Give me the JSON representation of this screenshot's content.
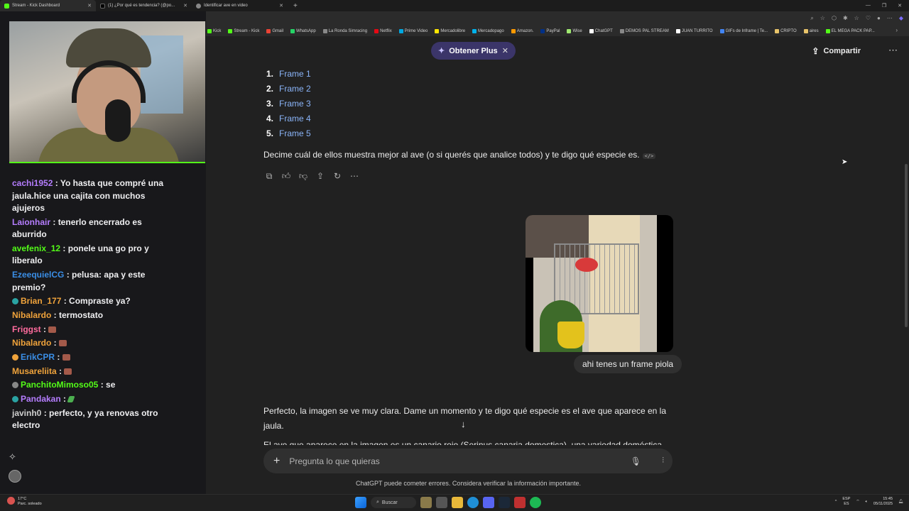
{
  "browser": {
    "tabs": [
      {
        "title": "Stream - Kick Dashboard",
        "favicon_color": "#53fc18"
      },
      {
        "title": "(1) ¿Por qué es tendencia? (@po...",
        "favicon_color": "#000000"
      },
      {
        "title": "Identificar ave en video",
        "favicon_color": "#888888"
      }
    ],
    "new_tab": "+",
    "bookmarks": [
      {
        "label": "Kick",
        "color": "#53fc18"
      },
      {
        "label": "Stream - Kick",
        "color": "#53fc18"
      },
      {
        "label": "Gmail",
        "color": "#ea4335"
      },
      {
        "label": "WhatsApp",
        "color": "#25d366"
      },
      {
        "label": "La Ronda Simracing",
        "color": "#888888"
      },
      {
        "label": "Netflix",
        "color": "#e50914"
      },
      {
        "label": "Prime Video",
        "color": "#00a8e1"
      },
      {
        "label": "Mercadolibre",
        "color": "#ffe600"
      },
      {
        "label": "Mercadopago",
        "color": "#00b1ea"
      },
      {
        "label": "Amazon.",
        "color": "#ff9900"
      },
      {
        "label": "PayPal",
        "color": "#003087"
      },
      {
        "label": "Wise",
        "color": "#9fe870"
      },
      {
        "label": "ChatGPT",
        "color": "#ffffff"
      },
      {
        "label": "DEMOS PAL STREAM",
        "color": "#888888"
      },
      {
        "label": "JUAN TURRITO",
        "color": "#ffffff"
      },
      {
        "label": "GIFs de Inframe | Te...",
        "color": "#4285f4"
      },
      {
        "label": "CRIPTO",
        "color": "#e8c46a"
      },
      {
        "label": "aires",
        "color": "#e8c46a"
      },
      {
        "label": "EL MEGA PACK PAP...",
        "color": "#53fc18"
      }
    ]
  },
  "chat": {
    "messages": [
      {
        "user": "cachi1952",
        "color": "#b57dff",
        "badge": "",
        "text": "Yo hasta que compré una jaula.hice una cajita con muchos ajujeros",
        "emote": ""
      },
      {
        "user": "Laionhair",
        "color": "#b57dff",
        "badge": "",
        "text": "tenerlo encerrado es aburrido",
        "emote": ""
      },
      {
        "user": "avefenix_12",
        "color": "#53fc18",
        "badge": "",
        "text": "ponele una go pro y liberalo",
        "emote": ""
      },
      {
        "user": "EzeequielCG",
        "color": "#3a8ee6",
        "badge": "",
        "text": "pelusa: apa y este premio?",
        "emote": ""
      },
      {
        "user": "Brian_177",
        "color": "#f0a33b",
        "badge": "#2aa3a3",
        "text": "Compraste ya?",
        "emote": ""
      },
      {
        "user": "Nibalardo",
        "color": "#f0a33b",
        "badge": "",
        "text": "termostato",
        "emote": ""
      },
      {
        "user": "Friggst",
        "color": "#ff6b9d",
        "badge": "",
        "text": "",
        "emote": "red"
      },
      {
        "user": "Nibalardo",
        "color": "#f0a33b",
        "badge": "",
        "text": "",
        "emote": "red"
      },
      {
        "user": "ErikCPR",
        "color": "#3a8ee6",
        "badge": "#f0a33b",
        "text": "",
        "emote": "red"
      },
      {
        "user": "Musareliita",
        "color": "#f0a33b",
        "badge": "",
        "text": "",
        "emote": "red"
      },
      {
        "user": "PanchitoMimoso05",
        "color": "#53fc18",
        "badge": "#888888",
        "text": "se",
        "emote": ""
      },
      {
        "user": "Pandakan",
        "color": "#b57dff",
        "badge": "#2aa3a3",
        "text": "",
        "emote": "green"
      },
      {
        "user": "javinh0",
        "color": "#cfcfcf",
        "badge": "",
        "text": "perfecto, y ya renovas otro electro",
        "emote": ""
      }
    ]
  },
  "chatgpt": {
    "get_plus": "Obtener Plus",
    "share": "Compartir",
    "frames": [
      "Frame 1",
      "Frame 2",
      "Frame 3",
      "Frame 4",
      "Frame 5"
    ],
    "frame_numbers": [
      "1.",
      "2.",
      "3.",
      "4.",
      "5."
    ],
    "assistant_text": "Decime cuál de ellos muestra mejor al ave (o si querés que analice todos) y te digo qué especie es.",
    "code_chip": "</>",
    "user_message": "ahi tenes un frame piola",
    "answer": "Perfecto, la imagen se ve muy clara. Dame un momento y te digo qué especie es el ave que aparece en la jaula.",
    "answer_cut": "El ave que aparece en la imagen es un canario rojo (Serinus canaria domestica), una variedad doméstica del",
    "composer_placeholder": "Pregunta lo que quieras",
    "disclaimer": "ChatGPT puede cometer errores. Considera verificar la información importante."
  },
  "taskbar": {
    "weather_temp": "17°C",
    "weather_desc": "Parc. soleado",
    "search": "Buscar",
    "lang": "ESP",
    "lang_sub": "ES",
    "time": "15:45",
    "date": "05/11/2025"
  }
}
